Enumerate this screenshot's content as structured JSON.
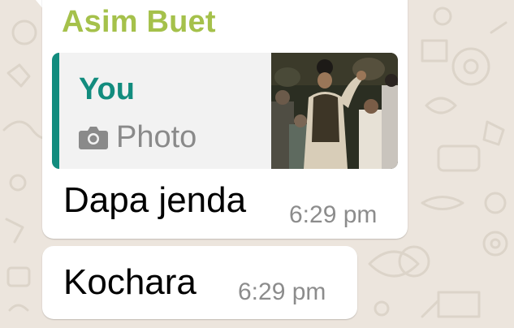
{
  "chat": {
    "messages": [
      {
        "sender": "Asim Buet",
        "sender_color": "#a5c14b",
        "reply_to": {
          "author": "You",
          "author_color": "#128c7e",
          "media_icon": "camera-icon",
          "media_label": "Photo"
        },
        "text": "Dapa jenda",
        "time": "6:29 pm"
      },
      {
        "text": "Kochara",
        "time": "6:29 pm"
      }
    ]
  }
}
